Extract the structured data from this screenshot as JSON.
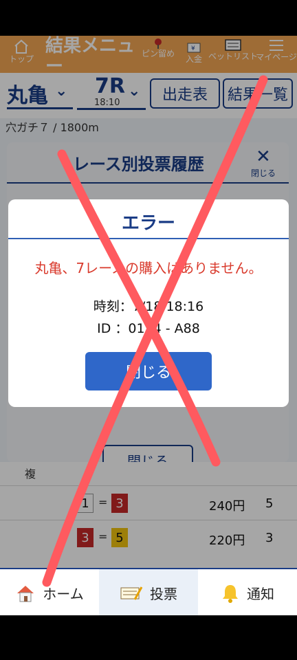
{
  "topnav": {
    "home": "トップ",
    "title": "結果メニュー",
    "pin": "ピン留め",
    "deposit": "入金",
    "betlist": "ベットリスト",
    "mypage": "マイページ"
  },
  "race": {
    "venue": "丸亀",
    "race_no": "7R",
    "time": "18:10",
    "btn_entries": "出走表",
    "btn_results": "結果一覧",
    "subinfo": "穴ガチ７ / 1800m"
  },
  "panel": {
    "title": "・レース別投票履歴",
    "close_icon": "✕",
    "close_label": "閉じる",
    "close_button": "閉じる"
  },
  "table": {
    "row_label": "複",
    "rows": [
      {
        "a": "1",
        "b": "3",
        "amount": "240円",
        "count": "5"
      },
      {
        "a": "3",
        "b": "5",
        "amount": "220円",
        "count": "3"
      }
    ]
  },
  "bottom_nav": {
    "home": "ホーム",
    "vote": "投票",
    "notify": "通知"
  },
  "dialog": {
    "title": "エラー",
    "message": "丸亀、7レースの購入はありません。",
    "time_line": "時刻：7/18 18:16",
    "id_line": "ID ：0134 - A88",
    "button": "閉じる"
  },
  "colors": {
    "accent": "#1a3c86",
    "header": "#f3a654",
    "error": "#d93a2c",
    "button": "#2f67c9",
    "cross": "#ff5a5f"
  }
}
